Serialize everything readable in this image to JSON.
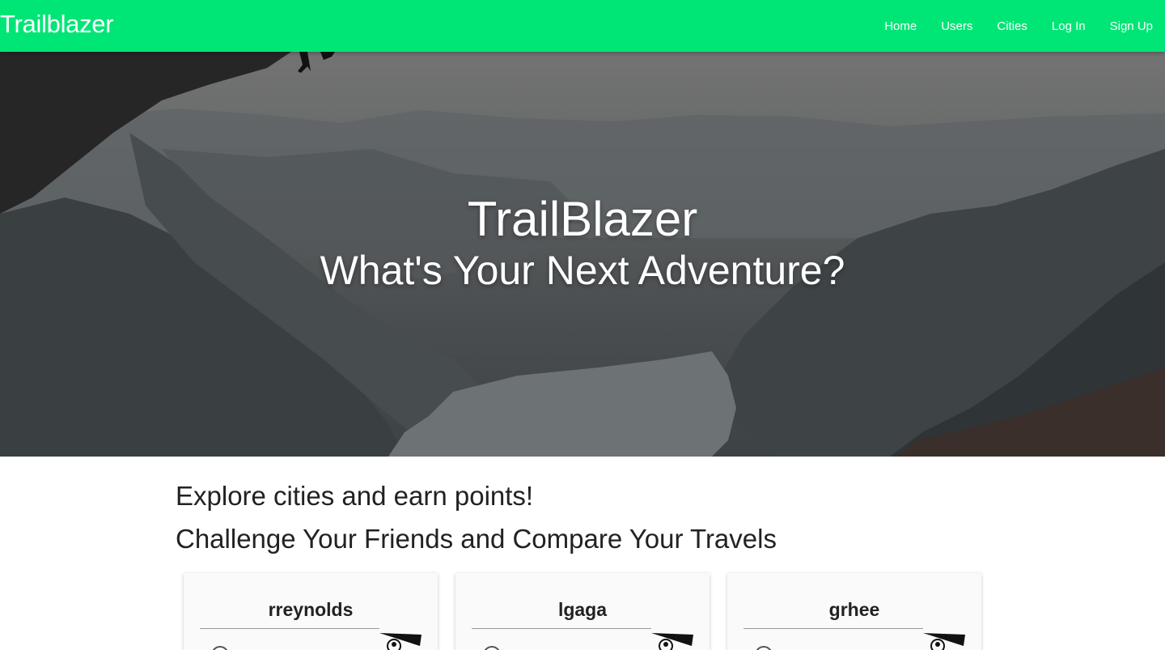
{
  "navbar": {
    "brand": "Trailblazer",
    "links": [
      "Home",
      "Users",
      "Cities",
      "Log In",
      "Sign Up"
    ],
    "background": "#00e676"
  },
  "hero": {
    "title": "TrailBlazer",
    "subtitle": "What's Your Next Adventure?"
  },
  "content": {
    "tagline_1": "Explore cities and earn points!",
    "tagline_2": "Challenge Your Friends and Compare Your Travels"
  },
  "users": [
    {
      "username": "rreynolds",
      "icon": "hang-glider-icon"
    },
    {
      "username": "lgaga",
      "icon": "hang-glider-icon"
    },
    {
      "username": "grhee",
      "icon": "hang-glider-icon"
    }
  ]
}
